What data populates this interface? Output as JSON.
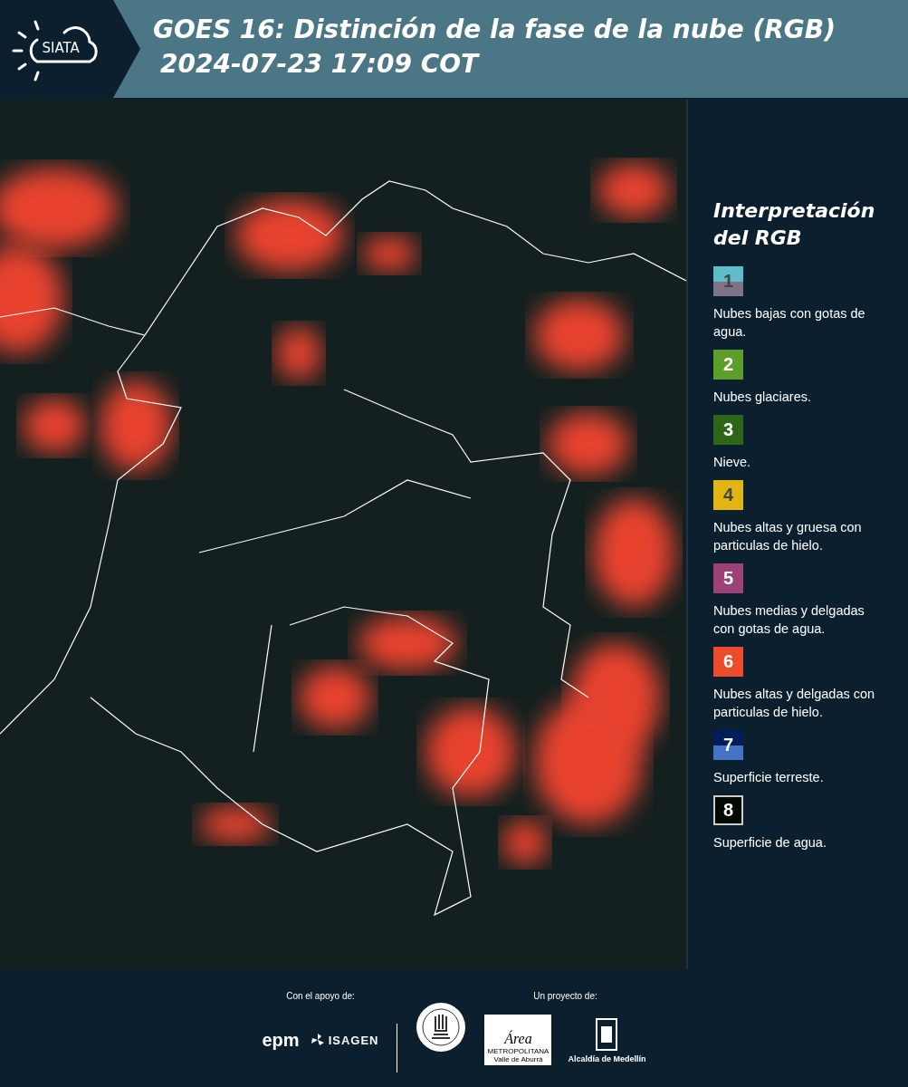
{
  "header": {
    "logo_text": "SIATA",
    "title": "GOES 16: Distinción de la fase de la nube (RGB)",
    "subtitle": "2024-07-23 17:09 COT"
  },
  "legend": {
    "title": "Interpretación del RGB",
    "items": [
      {
        "number": "1",
        "bands": [
          {
            "color": "#5fbcc9"
          },
          {
            "color": "#7f738a"
          }
        ],
        "label": "Nubes bajas con gotas de agua.",
        "outlined": false
      },
      {
        "number": "2",
        "bands": [
          {
            "color": "#5b9e2a"
          }
        ],
        "label": "Nubes glaciares.",
        "outlined": false
      },
      {
        "number": "3",
        "bands": [
          {
            "color": "#2d6618"
          }
        ],
        "label": "Nieve.",
        "outlined": false
      },
      {
        "number": "4",
        "bands": [
          {
            "color": "#e2b515"
          }
        ],
        "label": "Nubes altas y gruesa con particulas de hielo.",
        "outlined": false
      },
      {
        "number": "5",
        "bands": [
          {
            "color": "#9c4277"
          }
        ],
        "label": "Nubes medias y delgadas con gotas de agua.",
        "outlined": false
      },
      {
        "number": "6",
        "bands": [
          {
            "color": "#ee4b2b"
          }
        ],
        "label": "Nubes altas y delgadas con particulas de hielo.",
        "outlined": false
      },
      {
        "number": "7",
        "bands": [
          {
            "color": "#001d5c"
          },
          {
            "color": "#4472c4"
          }
        ],
        "label": "Superficie terreste.",
        "outlined": false
      },
      {
        "number": "8",
        "bands": [
          {
            "color": "#000a00"
          }
        ],
        "label": "Superficie de agua.",
        "outlined": true
      }
    ]
  },
  "footer": {
    "support_label": "Con el apoyo de:",
    "project_label": "Un proyecto de:",
    "epm": "epm",
    "isagen": "ISAGEN",
    "area_script": "Área",
    "area_name": "METROPOLITANA",
    "area_sub": "Valle de Aburrá",
    "alcaldia": "Alcaldía de Medellín"
  }
}
